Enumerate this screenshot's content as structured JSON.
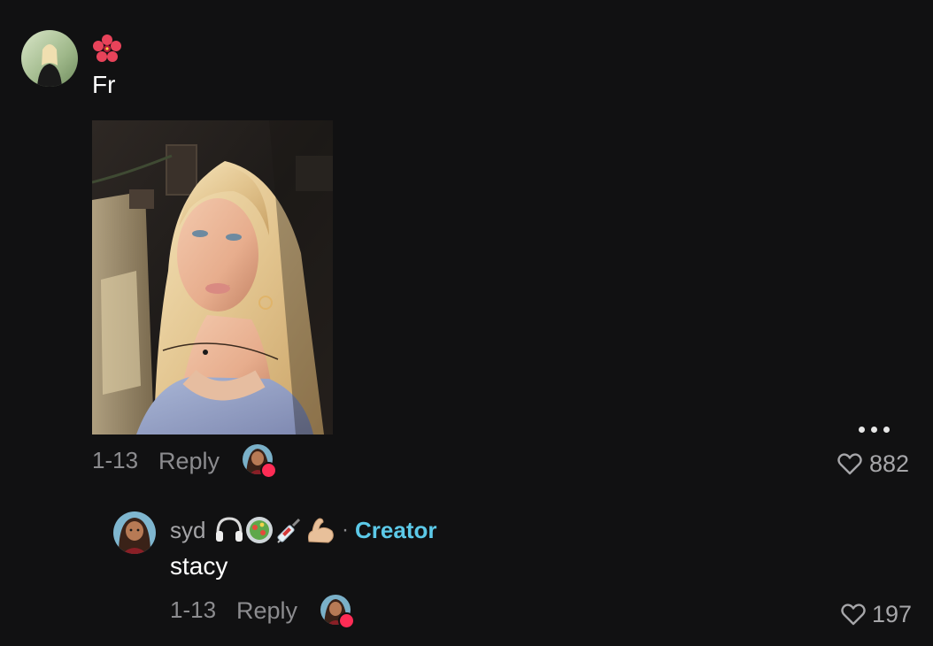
{
  "comment": {
    "username_emoji": "🌺",
    "text": "Fr",
    "date": "1-13",
    "reply_label": "Reply",
    "like_count": "882",
    "more_icon": "more-horizontal-icon",
    "heart_icon": "heart-outline-icon"
  },
  "reply": {
    "username": "syd",
    "username_emojis": "🎧🥗💉💪🏼",
    "separator": "·",
    "creator_label": "Creator",
    "text": "stacy",
    "date": "1-13",
    "reply_label": "Reply",
    "like_count": "197"
  },
  "colors": {
    "background": "#111112",
    "creator": "#5cc9e8",
    "liked_badge": "#fe2c55",
    "secondary_text": "#8c8c8f"
  }
}
